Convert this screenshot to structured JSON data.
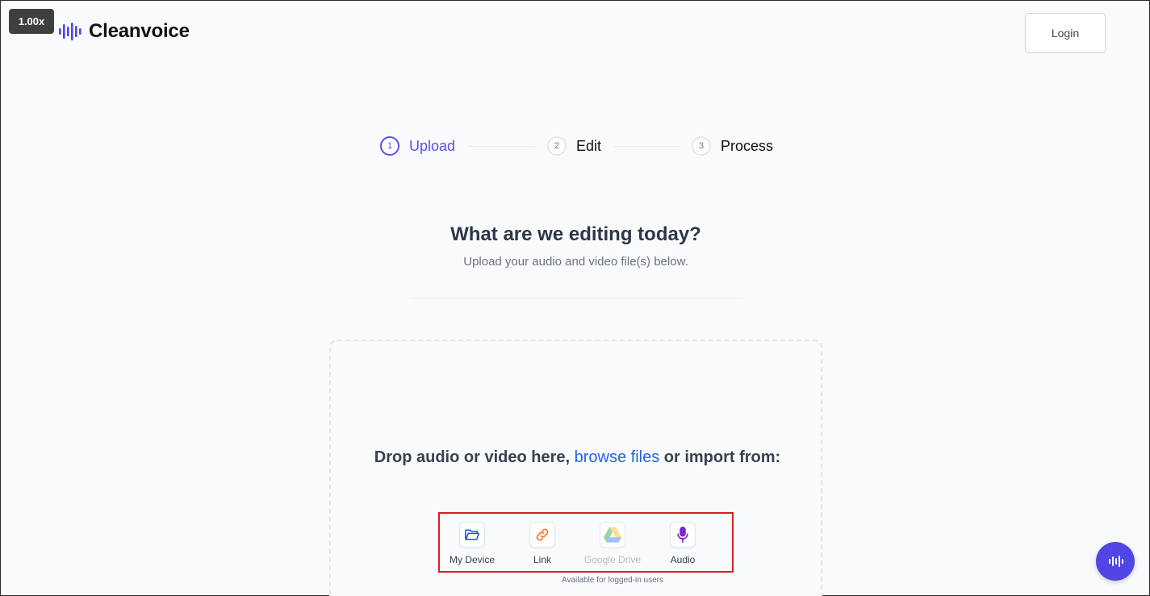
{
  "zoom_badge": "1.00x",
  "header": {
    "brand": "Cleanvoice",
    "login_label": "Login"
  },
  "steps": [
    {
      "number": "1",
      "label": "Upload",
      "active": true
    },
    {
      "number": "2",
      "label": "Edit",
      "active": false
    },
    {
      "number": "3",
      "label": "Process",
      "active": false
    }
  ],
  "main": {
    "headline": "What are we editing today?",
    "subline": "Upload your audio and video file(s) below."
  },
  "dropzone": {
    "text_before": "Drop audio or video here,",
    "browse_label": "browse files",
    "text_after": "or import from:",
    "sources": [
      {
        "label": "My Device",
        "icon": "folder-icon",
        "enabled": true
      },
      {
        "label": "Link",
        "icon": "link-icon",
        "enabled": true
      },
      {
        "label": "Google Drive",
        "icon": "google-drive-icon",
        "enabled": false
      },
      {
        "label": "Audio",
        "icon": "microphone-icon",
        "enabled": true
      }
    ],
    "note": "Available for logged-in users"
  },
  "colors": {
    "accent": "#5b4ef0",
    "link": "#2563eb",
    "highlight_border": "#d91c24",
    "chat_button": "#4f46e5"
  }
}
